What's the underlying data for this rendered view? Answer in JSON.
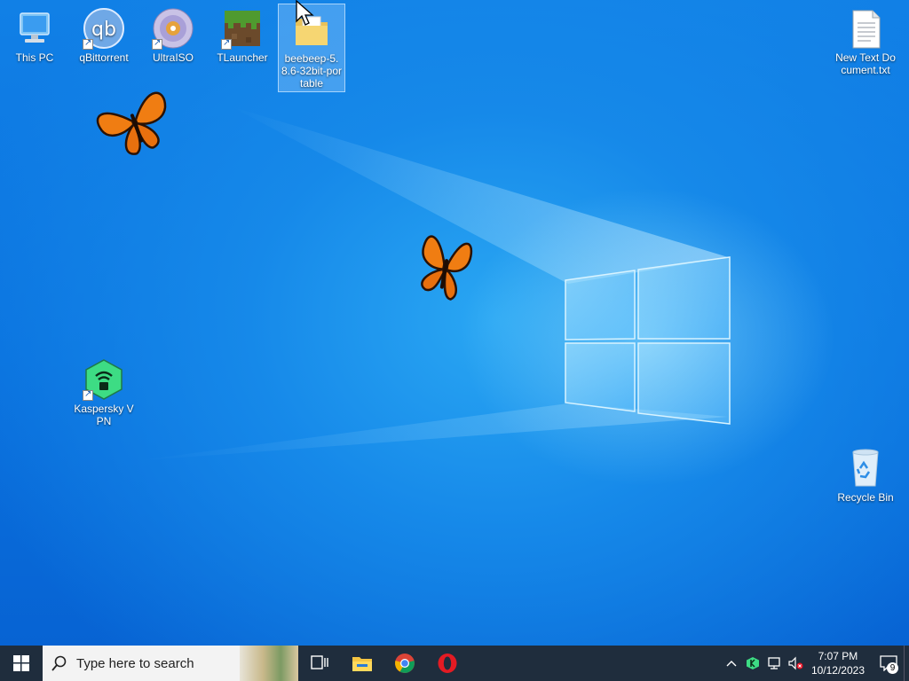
{
  "desktop": {
    "icons": [
      {
        "label": "This PC",
        "icon": "this-pc-icon"
      },
      {
        "label": "qBittorrent",
        "icon": "qbittorrent-icon"
      },
      {
        "label": "UltraISO",
        "icon": "ultraiso-icon"
      },
      {
        "label": "TLauncher",
        "icon": "tlauncher-icon"
      },
      {
        "label": "beebeep-5.8.6-32bit-portable",
        "icon": "folder-icon",
        "selected": true
      },
      {
        "label": "New Text Document.txt",
        "icon": "text-file-icon"
      },
      {
        "label": "Kaspersky VPN",
        "icon": "kaspersky-vpn-icon"
      },
      {
        "label": "Recycle Bin",
        "icon": "recycle-bin-icon"
      }
    ],
    "qb_glyph": "qb"
  },
  "taskbar": {
    "search_placeholder": "Type here to search",
    "pinned": [
      "file-explorer-icon",
      "chrome-icon",
      "opera-icon"
    ],
    "clock": {
      "time": "7:07 PM",
      "date": "10/12/2023"
    },
    "notification_count": "9"
  },
  "colors": {
    "taskbar": "#1f2d3d",
    "accent": "#0a72df"
  }
}
